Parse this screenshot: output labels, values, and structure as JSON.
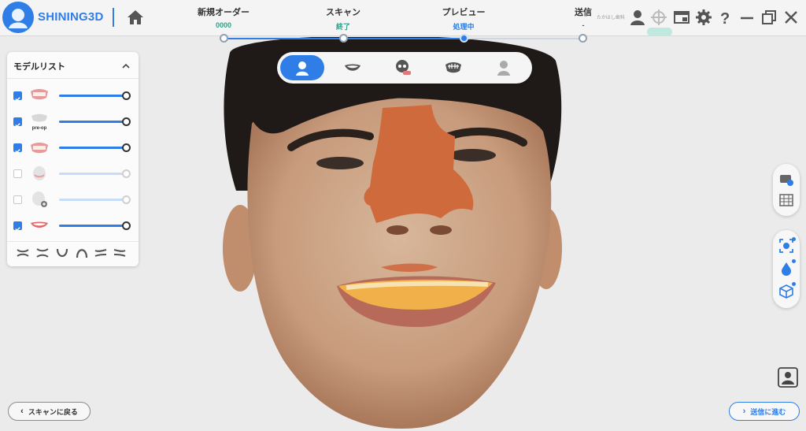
{
  "app": {
    "brand": "SHINING3D",
    "user_name": "たかはし歯科"
  },
  "steps": [
    {
      "title": "新規オーダー",
      "status": "0000",
      "status_color": "#2aa58a",
      "node": "done"
    },
    {
      "title": "スキャン",
      "status": "終了",
      "status_color": "#2aa58a",
      "node": "done"
    },
    {
      "title": "プレビュー",
      "status": "処理中",
      "status_color": "#2f7de6",
      "node": "active"
    },
    {
      "title": "送信",
      "status": "-",
      "status_color": "#555555",
      "node": "pending"
    }
  ],
  "progress_fraction": 0.67,
  "top_icons": [
    "account-icon",
    "crosshair-icon",
    "window-icon",
    "gear-icon",
    "help-icon",
    "minimize-icon",
    "restore-icon",
    "close-icon"
  ],
  "model_panel": {
    "title": "モデルリスト",
    "rows": [
      {
        "name": "upper-jaw",
        "checked": true,
        "label": "",
        "opacity": 1.0
      },
      {
        "name": "preop",
        "checked": true,
        "label": "pre-op",
        "opacity": 1.0
      },
      {
        "name": "lower-jaw",
        "checked": true,
        "label": "",
        "opacity": 1.0
      },
      {
        "name": "face-scan",
        "checked": false,
        "label": "",
        "opacity": 1.0
      },
      {
        "name": "add-face",
        "checked": false,
        "label": "",
        "opacity": 1.0
      },
      {
        "name": "smile",
        "checked": true,
        "label": "",
        "opacity": 1.0
      }
    ],
    "jaw_icons": [
      "bite-open-icon",
      "bite-side-icon",
      "lower-arch-icon",
      "upper-arch-icon",
      "bite-tilt-left-icon",
      "bite-tilt-right-icon"
    ]
  },
  "view_toolbar": {
    "items": [
      "face-view-icon",
      "smile-view-icon",
      "skull-view-icon",
      "teeth-view-icon",
      "profile-view-icon"
    ],
    "active_index": 0
  },
  "right_tools": {
    "group1": [
      "jaw-settings-icon",
      "jaw-grid-icon"
    ],
    "group2": [
      "face-detect-icon",
      "color-drop-icon",
      "cube-icon"
    ]
  },
  "nav": {
    "back_label": "スキャンに戻る",
    "next_label": "送信に進む"
  },
  "colors": {
    "accent": "#2f7de6",
    "done": "#2aa58a"
  }
}
